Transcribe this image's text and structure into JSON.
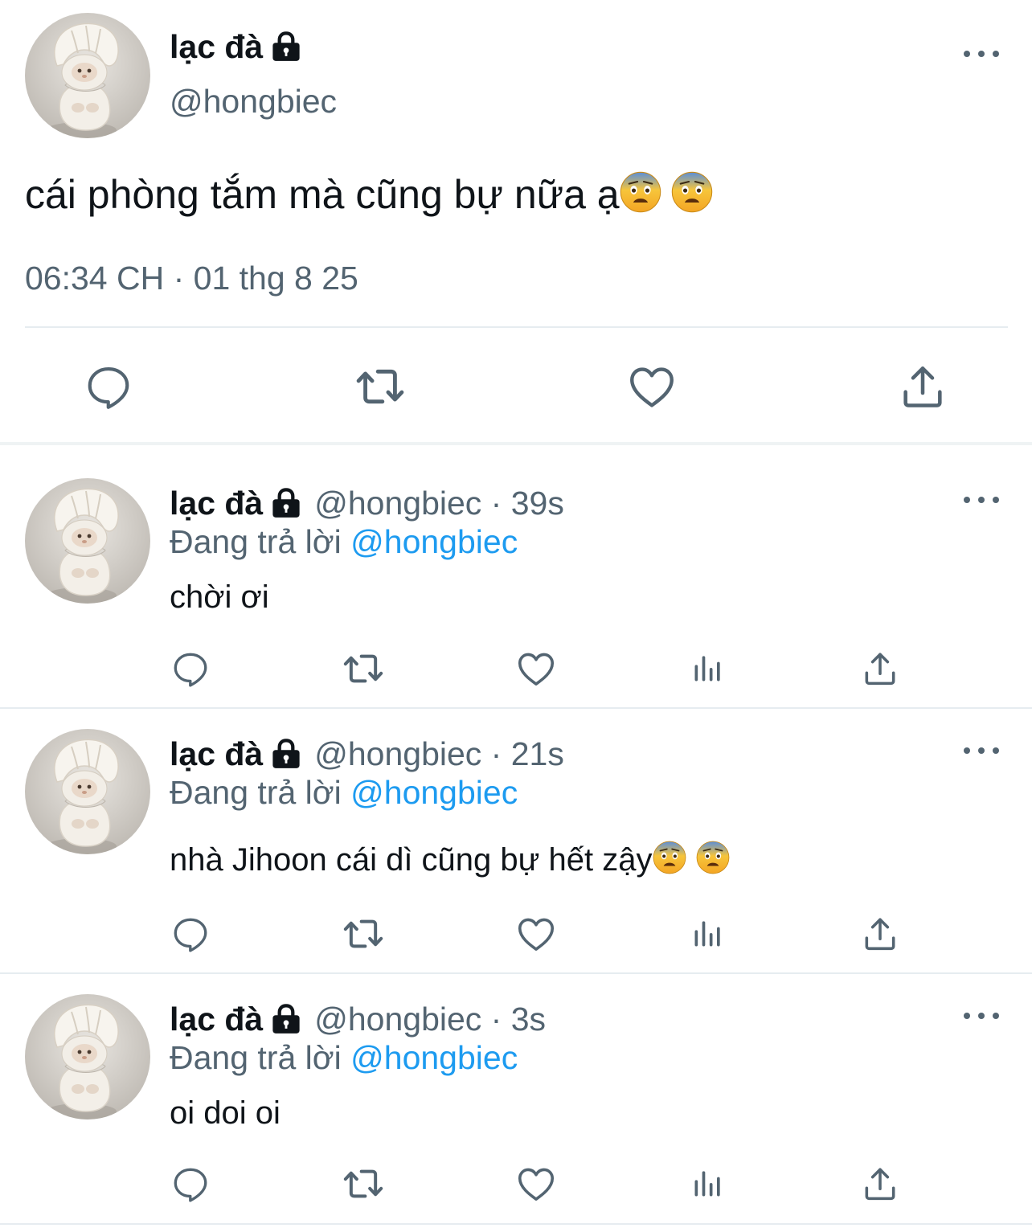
{
  "main_tweet": {
    "display_name": "lạc đà",
    "handle": "@hongbiec",
    "text": "cái phòng tắm mà cũng bự nữa ạ",
    "text_emoji": "fearful-face-emoji",
    "timestamp": "06:34 CH · 01 thg 8 25",
    "actions": [
      "reply-icon",
      "retweet-icon",
      "like-icon",
      "share-icon"
    ]
  },
  "replies": [
    {
      "display_name": "lạc đà",
      "handle": "@hongbiec",
      "time": "39s",
      "replying_label": "Đang trả lời",
      "replying_to": "@hongbiec",
      "text": "chời ơi"
    },
    {
      "display_name": "lạc đà",
      "handle": "@hongbiec",
      "time": "21s",
      "replying_label": "Đang trả lời",
      "replying_to": "@hongbiec",
      "text": "nhà Jihoon cái dì cũng bự hết zậy"
    },
    {
      "display_name": "lạc đà",
      "handle": "@hongbiec",
      "time": "3s",
      "replying_label": "Đang trả lời",
      "replying_to": "@hongbiec",
      "text": "oi doi oi"
    }
  ],
  "colors": {
    "text": "#0f1419",
    "secondary": "#536471",
    "link": "#1d9bf0",
    "divider": "#e6ecf0"
  }
}
